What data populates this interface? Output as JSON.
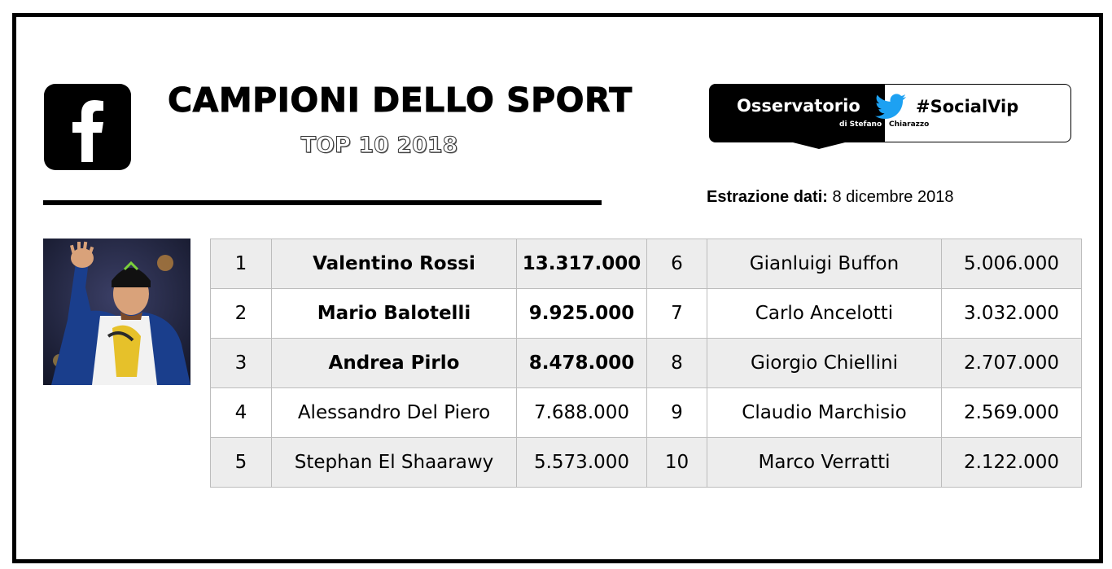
{
  "header": {
    "title": "CAMPIONI DELLO SPORT",
    "subtitle": "TOP 10 2018",
    "social_icon": "facebook-icon"
  },
  "badge": {
    "brand": "Osservatorio",
    "byline_a": "di Stefano ",
    "byline_b": "Chiarazzo",
    "hashtag": "#SocialVip",
    "icon": "twitter-bird-icon"
  },
  "extraction": {
    "label": "Estrazione dati",
    "separator": ":",
    "date": " 8 dicembre 2018"
  },
  "photo": {
    "icon": "athlete-photo"
  },
  "rows": [
    {
      "left": {
        "rank": "1",
        "name": "Valentino Rossi",
        "value": "13.317.000"
      },
      "right": {
        "rank": "6",
        "name": "Gianluigi Buffon",
        "value": "5.006.000"
      }
    },
    {
      "left": {
        "rank": "2",
        "name": "Mario Balotelli",
        "value": "9.925.000"
      },
      "right": {
        "rank": "7",
        "name": "Carlo Ancelotti",
        "value": "3.032.000"
      }
    },
    {
      "left": {
        "rank": "3",
        "name": "Andrea Pirlo",
        "value": "8.478.000"
      },
      "right": {
        "rank": "8",
        "name": "Giorgio Chiellini",
        "value": "2.707.000"
      }
    },
    {
      "left": {
        "rank": "4",
        "name": "Alessandro Del Piero",
        "value": "7.688.000"
      },
      "right": {
        "rank": "9",
        "name": "Claudio Marchisio",
        "value": "2.569.000"
      }
    },
    {
      "left": {
        "rank": "5",
        "name": "Stephan El Shaarawy",
        "value": "5.573.000"
      },
      "right": {
        "rank": "10",
        "name": "Marco Verratti",
        "value": "2.122.000"
      }
    }
  ],
  "colors": {
    "row_shade": "#ededed",
    "row_plain": "#ffffff",
    "border": "#bdbdbd",
    "ink": "#000000"
  }
}
